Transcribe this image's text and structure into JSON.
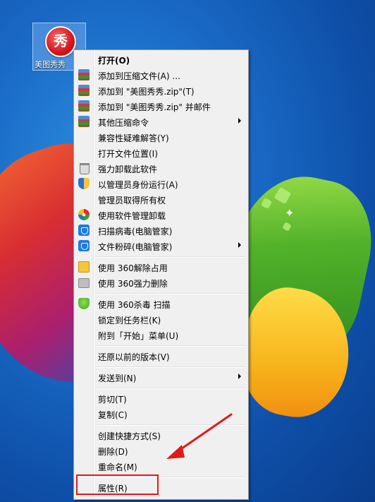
{
  "desktop": {
    "icon": {
      "label": "美图秀秀",
      "logo_text": "秀",
      "icon": "meitu-logo-icon"
    }
  },
  "context_menu": {
    "items": [
      {
        "label": "打开(O)",
        "bold": true,
        "icon": null
      },
      {
        "label": "添加到压缩文件(A) ...",
        "icon": "winrar-icon"
      },
      {
        "label": "添加到 \"美图秀秀.zip\"(T)",
        "icon": "winrar-icon"
      },
      {
        "label": "添加到 \"美图秀秀.zip\" 并邮件",
        "icon": "winrar-icon"
      },
      {
        "label": "其他压缩命令",
        "icon": "winrar-icon",
        "submenu": true
      },
      {
        "label": "兼容性疑难解答(Y)",
        "icon": null
      },
      {
        "label": "打开文件位置(I)",
        "icon": null
      },
      {
        "label": "强力卸载此软件",
        "icon": "trash-icon"
      },
      {
        "label": "以管理员身份运行(A)",
        "icon": "uac-shield-icon"
      },
      {
        "label": "管理员取得所有权",
        "icon": null
      },
      {
        "label": "使用软件管理卸载",
        "icon": "software-manager-icon"
      },
      {
        "label": "扫描病毒(电脑管家)",
        "icon": "pc-manager-icon"
      },
      {
        "label": "文件粉碎(电脑管家)",
        "icon": "pc-manager-icon",
        "submenu": true
      },
      {
        "label": "使用 360解除占用",
        "icon": "unlock-360-icon"
      },
      {
        "label": "使用 360强力删除",
        "icon": "shredder-360-icon"
      },
      {
        "label": "使用 360杀毒 扫描",
        "icon": "antivirus-360-icon"
      },
      {
        "label": "锁定到任务栏(K)",
        "icon": null
      },
      {
        "label": "附到「开始」菜单(U)",
        "icon": null
      },
      {
        "label": "还原以前的版本(V)",
        "icon": null
      },
      {
        "label": "发送到(N)",
        "icon": null,
        "submenu": true
      },
      {
        "label": "剪切(T)",
        "icon": null
      },
      {
        "label": "复制(C)",
        "icon": null
      },
      {
        "label": "创建快捷方式(S)",
        "icon": null
      },
      {
        "label": "删除(D)",
        "icon": null
      },
      {
        "label": "重命名(M)",
        "icon": null
      },
      {
        "label": "属性(R)",
        "icon": null,
        "highlighted": true
      }
    ]
  },
  "annotation": {
    "highlight_color": "#e01a1a"
  }
}
